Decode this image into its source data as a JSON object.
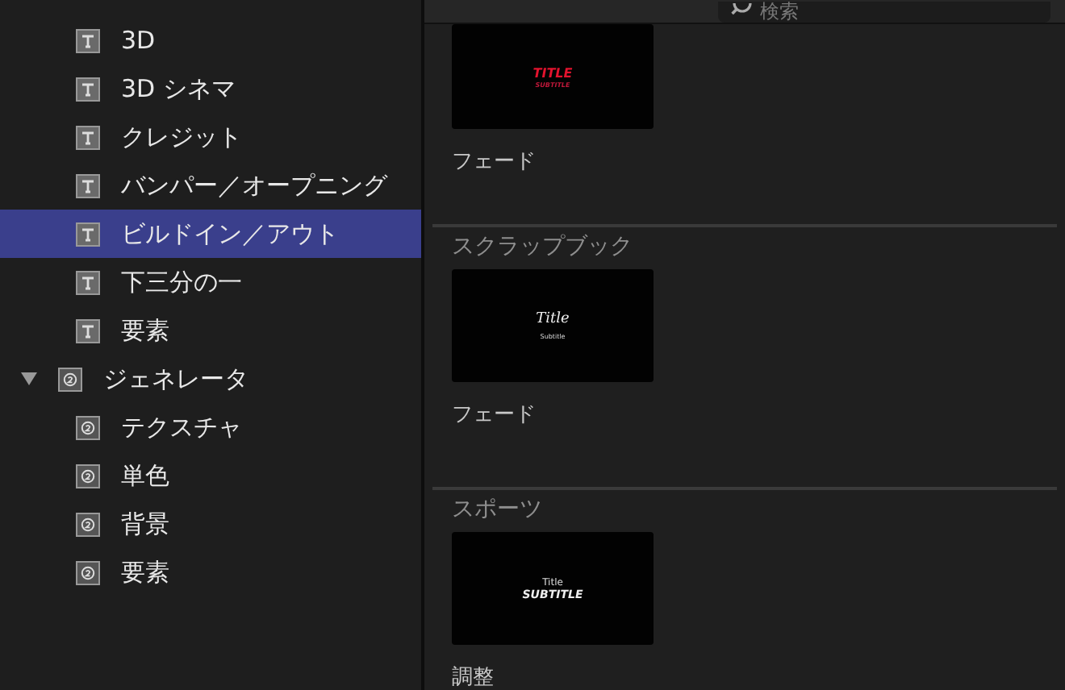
{
  "sidebar": {
    "items": [
      {
        "label": "3D",
        "kind": "title",
        "selected": false
      },
      {
        "label": "3D シネマ",
        "kind": "title",
        "selected": false
      },
      {
        "label": "クレジット",
        "kind": "title",
        "selected": false
      },
      {
        "label": "バンパー／オープニング",
        "kind": "title",
        "selected": false
      },
      {
        "label": "ビルドイン／アウト",
        "kind": "title",
        "selected": true
      },
      {
        "label": "下三分の一",
        "kind": "title",
        "selected": false
      },
      {
        "label": "要素",
        "kind": "title",
        "selected": false
      },
      {
        "label": "ジェネレータ",
        "kind": "generator",
        "selected": false,
        "expanded": true,
        "children": [
          {
            "label": "テクスチャ",
            "kind": "generator",
            "selected": false
          },
          {
            "label": "単色",
            "kind": "generator",
            "selected": false
          },
          {
            "label": "背景",
            "kind": "generator",
            "selected": false
          },
          {
            "label": "要素",
            "kind": "generator",
            "selected": false
          }
        ]
      }
    ]
  },
  "search": {
    "placeholder": "検索"
  },
  "sections": [
    {
      "items": [
        {
          "name": "フェード",
          "kind": "red",
          "title": "TITLE",
          "subtitle": "SUBTITLE"
        }
      ]
    },
    {
      "header": "スクラップブック",
      "items": [
        {
          "name": "フェード",
          "kind": "script",
          "title": "Title",
          "subtitle": "Subtitle"
        }
      ]
    },
    {
      "header": "スポーツ",
      "items": [
        {
          "name": "調整",
          "kind": "sport",
          "title": "Title",
          "subtitle": "SUBTITLE"
        }
      ]
    }
  ]
}
